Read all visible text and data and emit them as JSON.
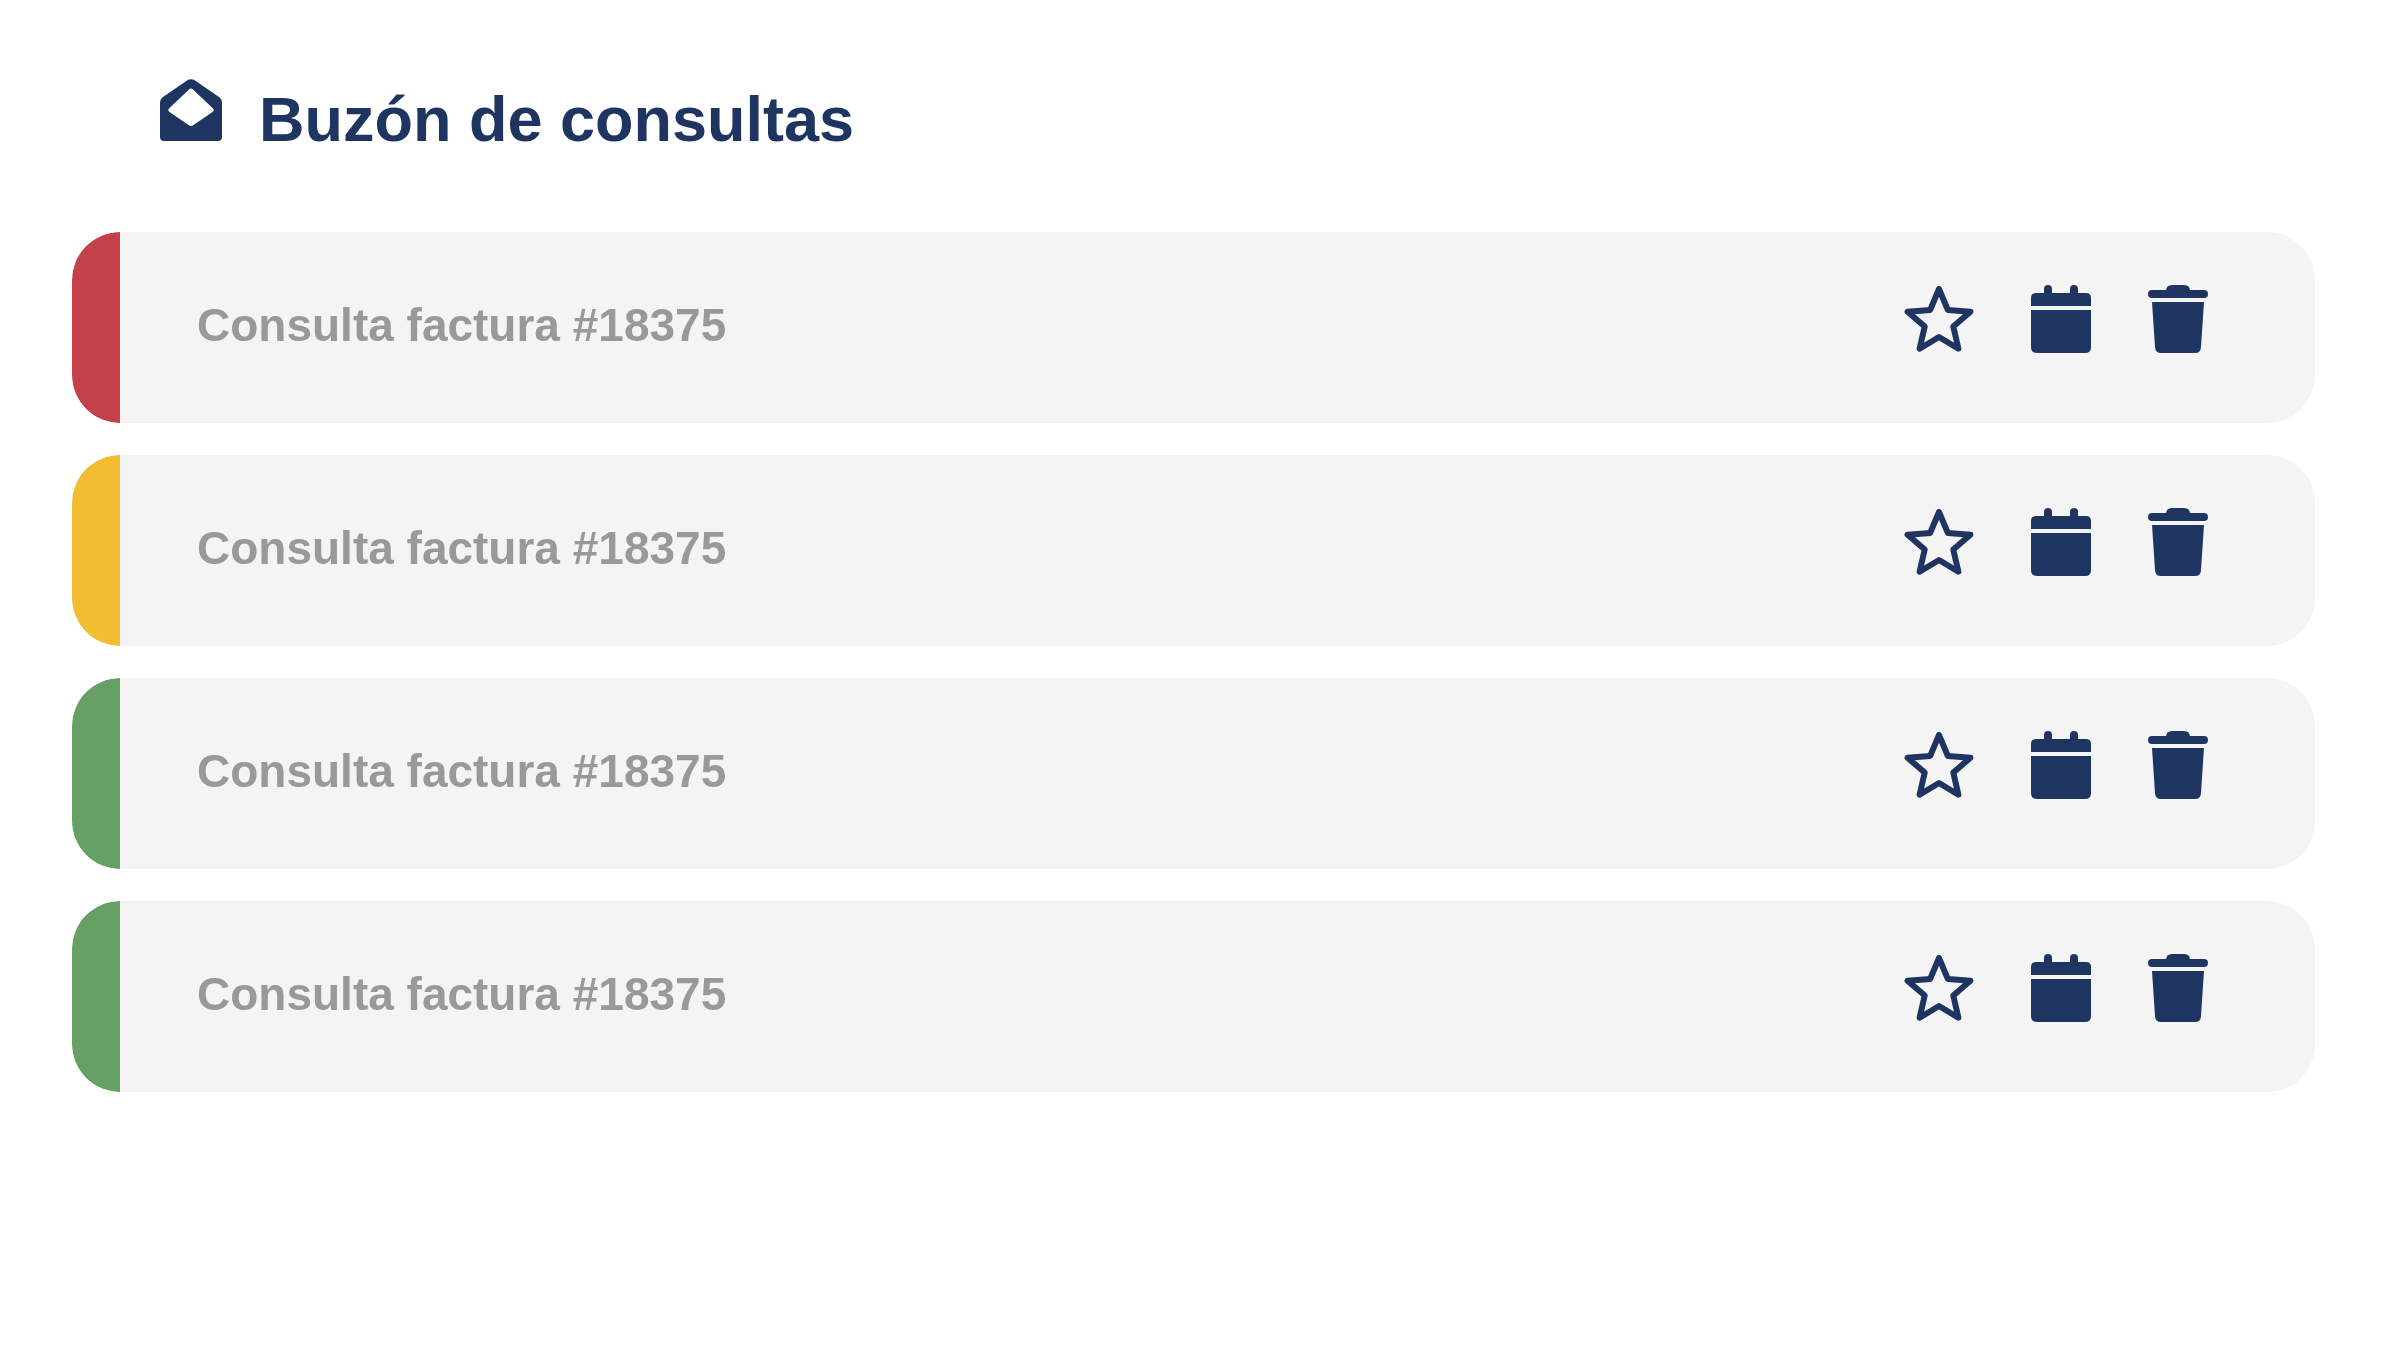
{
  "header": {
    "title": "Buzón de consultas"
  },
  "messages": [
    {
      "subject": "Consulta factura #18375",
      "color": "#c4414b",
      "starred": false
    },
    {
      "subject": "Consulta factura #18375",
      "color": "#f2bd30",
      "starred": false
    },
    {
      "subject": "Consulta factura #18375",
      "color": "#66a064",
      "starred": false
    },
    {
      "subject": "Consulta factura #18375",
      "color": "#66a064",
      "starred": false
    }
  ]
}
